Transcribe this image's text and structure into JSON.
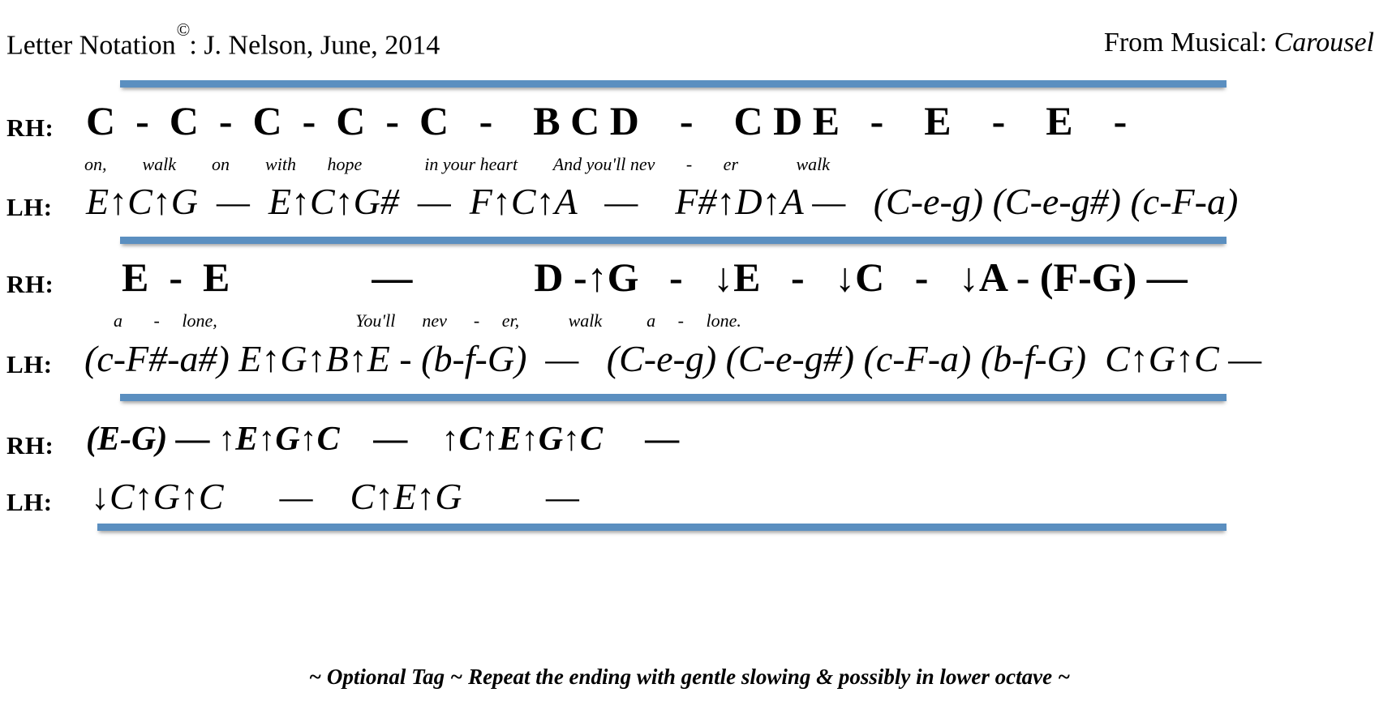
{
  "header": {
    "left_text": "Letter Notation",
    "copyright_mark": "©",
    "left_suffix": ": J. Nelson, June, 2014",
    "right_prefix": "From Musical: ",
    "musical_title": "Carousel"
  },
  "labels": {
    "right_hand": "RH:",
    "left_hand": "LH:"
  },
  "colors": {
    "rule": "#5b8fc0",
    "text": "#000000",
    "background": "#ffffff"
  },
  "systems": [
    {
      "id": "system-1",
      "rh_notes": "C  -  C  -  C  -  C  -  C   -    B C D    -    C D E   -    E    -    E    -",
      "lyrics": "on,        walk        on        with       hope              in your heart        And you'll nev       -       er             walk",
      "lh_notes": "E↑C↑G  —  E↑C↑G#  —  F↑C↑A   —    F#↑D↑A —   (C-e-g) (C-e-g#) (c-F-a)"
    },
    {
      "id": "system-2",
      "rh_notes": "E  -  E              —            D -↑G   -   ↓E   -   ↓C   -   ↓A - (F-G) —",
      "lyrics": "a       -     lone,                               You'll      nev      -     er,           walk          a     -     lone.",
      "lh_notes": "(c-F#-a#) E↑G↑B↑E - (b-f-G)  —   (C-e-g) (C-e-g#) (c-F-a) (b-f-G)  C↑G↑C —"
    },
    {
      "id": "system-3",
      "rh_notes": "(E-G) — ↑E↑G↑C    —    ↑C↑E↑G↑C     —",
      "lyrics": "",
      "lh_notes": "↓C↑G↑C      —    C↑E↑G         —"
    }
  ],
  "footer": {
    "text": "~  Optional Tag  ~  Repeat the ending with gentle slowing & possibly in lower octave  ~"
  }
}
